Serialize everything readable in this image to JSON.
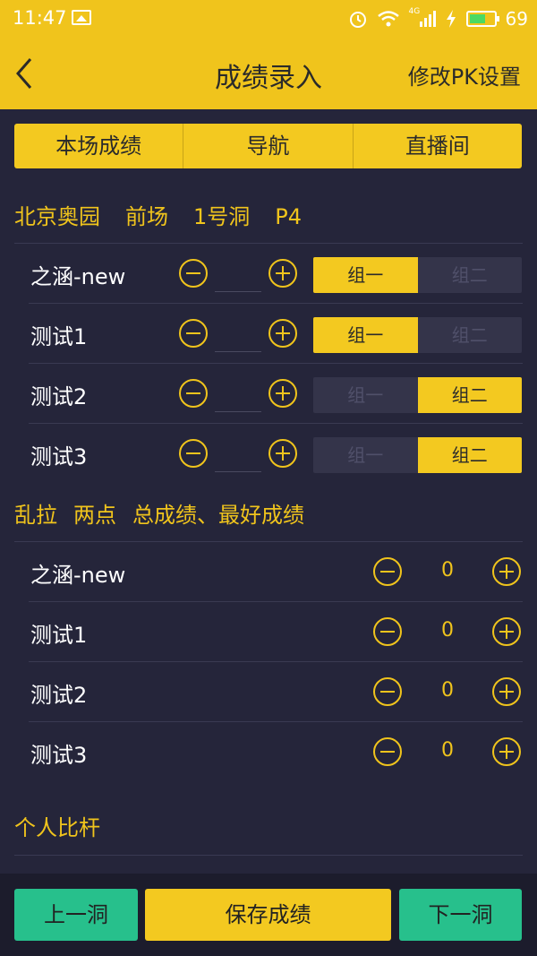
{
  "status_bar": {
    "time": "11:47",
    "network": "4G",
    "battery": "69",
    "battery_level": 0.69,
    "icons": [
      "image-icon",
      "alarm-icon",
      "wifi-icon",
      "signal-icon",
      "charging-icon",
      "battery-icon"
    ]
  },
  "header": {
    "title": "成绩录入",
    "action": "修改PK设置",
    "back_icon": "chevron-left-icon"
  },
  "tabs": [
    "本场成绩",
    "导航",
    "直播间"
  ],
  "course": {
    "name": "北京奥园",
    "side": "前场",
    "hole": "1号洞",
    "par": "P4"
  },
  "players": [
    {
      "name": "之涵-new",
      "group_a": "组一",
      "group_b": "组二",
      "selected": "a"
    },
    {
      "name": "测试1",
      "group_a": "组一",
      "group_b": "组二",
      "selected": "a"
    },
    {
      "name": "测试2",
      "group_a": "组一",
      "group_b": "组二",
      "selected": "b"
    },
    {
      "name": "测试3",
      "group_a": "组一",
      "group_b": "组二",
      "selected": "b"
    }
  ],
  "mode_section": {
    "mode": "乱拉",
    "points": "两点",
    "rules": "总成绩、最好成绩"
  },
  "mode_players": [
    {
      "name": "之涵-new",
      "value": "0"
    },
    {
      "name": "测试1",
      "value": "0"
    },
    {
      "name": "测试2",
      "value": "0"
    },
    {
      "name": "测试3",
      "value": "0"
    }
  ],
  "personal_section": {
    "title": "个人比杆"
  },
  "bottom": {
    "prev": "上一洞",
    "save": "保存成绩",
    "next": "下一洞"
  },
  "colors": {
    "accent": "#f0c41c",
    "background": "#25253a",
    "green": "#27c08c"
  }
}
